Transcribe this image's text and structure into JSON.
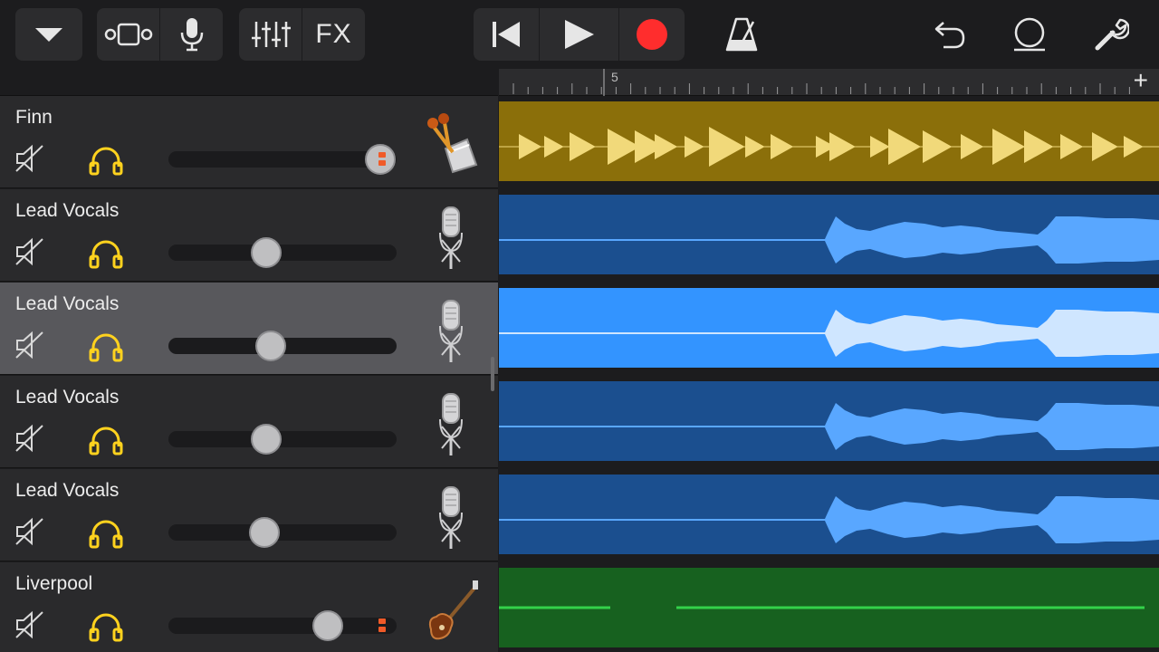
{
  "toolbar": {
    "fx_label": "FX",
    "icons": [
      "dropdown-icon",
      "tracks-view-icon",
      "microphone-icon",
      "mixer-icon",
      "fx-icon",
      "rewind-icon",
      "play-icon",
      "record-icon",
      "metronome-icon",
      "undo-icon",
      "loop-icon",
      "settings-wrench-icon"
    ]
  },
  "ruler": {
    "bar_number": "5",
    "add_label": "+"
  },
  "tracks": [
    {
      "name": "Finn",
      "volume": 0.93,
      "instrument": "percussion-icon",
      "selected": false,
      "meter": true,
      "region_color": "#8b6f0a"
    },
    {
      "name": "Lead Vocals",
      "volume": 0.43,
      "instrument": "microphone-icon",
      "selected": false,
      "meter": false,
      "region_color": "#1b4f8f"
    },
    {
      "name": "Lead Vocals",
      "volume": 0.45,
      "instrument": "microphone-icon",
      "selected": true,
      "meter": false,
      "region_color": "#3394ff"
    },
    {
      "name": "Lead Vocals",
      "volume": 0.43,
      "instrument": "microphone-icon",
      "selected": false,
      "meter": false,
      "region_color": "#1b4f8f"
    },
    {
      "name": "Lead Vocals",
      "volume": 0.42,
      "instrument": "microphone-icon",
      "selected": false,
      "meter": false,
      "region_color": "#1b4f8f"
    },
    {
      "name": "Liverpool",
      "volume": 0.7,
      "instrument": "bass-guitar-icon",
      "selected": false,
      "meter": true,
      "region_color": "#17611f"
    }
  ],
  "colors": {
    "accent_yellow": "#ffd21e",
    "record_red": "#ff2d2d",
    "meter_orange": "#f05a28",
    "beat_region": "#8b6f0a",
    "beat_mark": "#f1d97a",
    "audio_region": "#1b4f8f",
    "audio_wave": "#59a7ff",
    "audio_selected": "#3394ff",
    "audio_selected_wave": "#cfe6ff",
    "bass_region": "#17611f",
    "bass_note": "#33d14a"
  }
}
